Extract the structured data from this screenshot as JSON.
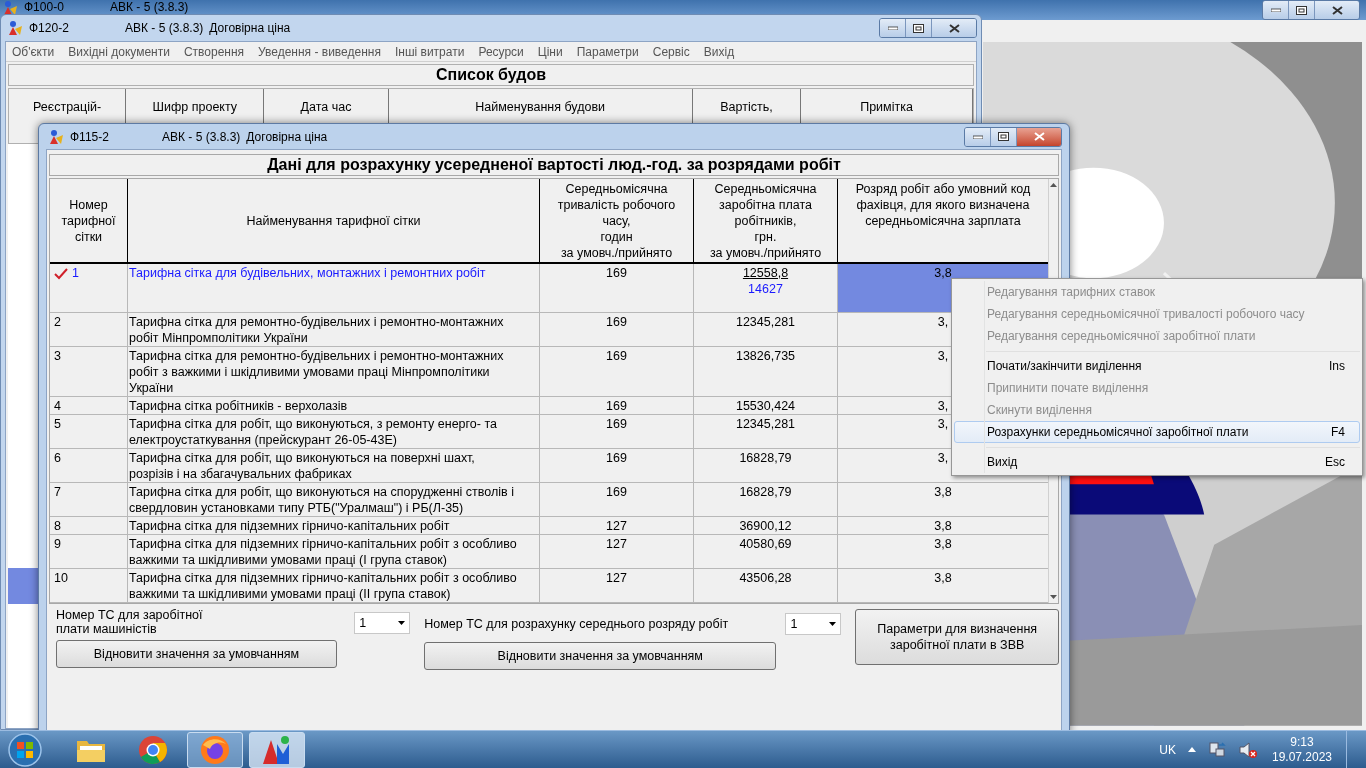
{
  "background_window": {
    "title": "Ф100-0",
    "app": "АВК - 5 (3.8.3)"
  },
  "list_window": {
    "title": "Ф120-2",
    "app": "АВК - 5 (3.8.3)",
    "mode": "Договірна ціна",
    "menu": [
      "Об'єкти",
      "Вихідні документи",
      "Створення",
      "Уведення - виведення",
      "Інші витрати",
      "Ресурси",
      "Ціни",
      "Параметри",
      "Сервіс",
      "Вихід"
    ],
    "heading": "Список будов",
    "columns": [
      "Реєстрацій-",
      "Шифр проекту",
      "Дата час",
      "Найменування будови",
      "Вартість,",
      "Примітка"
    ]
  },
  "dialog": {
    "title": "Ф115-2",
    "app": "АВК - 5 (3.8.3)",
    "mode": "Договірна ціна",
    "heading": "Дані для розрахунку усередненої вартості люд.-год. за розрядами робіт",
    "columns": [
      "Номер\nтарифної\nсітки",
      "Найменування тарифної сітки",
      "Середньомісячна\nтривалість робочого\nчасу,\nгодин\nза умовч./прийнято",
      "Середньомісячна\nзаробітна плата\nробітників,\nгрн.\nза умовч./прийнято",
      "Розряд робіт або умовний код\nфахівця, для якого визначена\nсередньомісячна зарплата"
    ],
    "rows": [
      {
        "number": "1",
        "selected": true,
        "name": "Тарифна сітка для будівельних, монтажних і ремонтних робіт",
        "hours": "169",
        "salary": "12558,8",
        "salary_accepted": "14627",
        "grade": "3,8"
      },
      {
        "number": "2",
        "selected": false,
        "name": "Тарифна сітка для ремонтно-будівельних і ремонтно-монтажних\nробіт Мінпромполітики України",
        "hours": "169",
        "salary": "12345,281",
        "grade": "3,"
      },
      {
        "number": "3",
        "selected": false,
        "name": "Тарифна сітка для ремонтно-будівельних і ремонтно-монтажних\nробіт з важкими і шкідливими умовами праці Мінпромполітики\nУкраїни",
        "hours": "169",
        "salary": "13826,735",
        "grade": "3,"
      },
      {
        "number": "4",
        "selected": false,
        "name": "Тарифна сітка робітників - верхолазів",
        "hours": "169",
        "salary": "15530,424",
        "grade": "3,"
      },
      {
        "number": "5",
        "selected": false,
        "name": "Тарифна сітка для робіт, що виконуються, з ремонту енерго- та\nелектроустаткування (прейскурант 26-05-43Е)",
        "hours": "169",
        "salary": "12345,281",
        "grade": "3,"
      },
      {
        "number": "6",
        "selected": false,
        "name": "Тарифна сітка для робіт, що виконуються на поверхні шахт,\nрозрізів і на збагачувальних фабриках",
        "hours": "169",
        "salary": "16828,79",
        "grade": "3,"
      },
      {
        "number": "7",
        "selected": false,
        "name": "Тарифна сітка для робіт, що виконуються на спорудженні стволів і\nсвердловин установками типу РТБ(\"Уралмаш\") і РБ(Л-35)",
        "hours": "169",
        "salary": "16828,79",
        "grade": "3,8"
      },
      {
        "number": "8",
        "selected": false,
        "name": "Тарифна сітка для підземних гірничо-капітальних робіт",
        "hours": "127",
        "salary": "36900,12",
        "grade": "3,8"
      },
      {
        "number": "9",
        "selected": false,
        "name": "Тарифна сітка для підземних гірничо-капітальних робіт з особливо\nважкими та шкідливими умовами праці (І група ставок)",
        "hours": "127",
        "salary": "40580,69",
        "grade": "3,8"
      },
      {
        "number": "10",
        "selected": false,
        "name": "Тарифна сітка для підземних гірничо-капітальних робіт з особливо\nважкими та шкідливими умовами праці (ІІ група ставок)",
        "hours": "127",
        "salary": "43506,28",
        "grade": "3,8"
      }
    ],
    "machinist_label": "Номер ТС для заробітної\nплати машиністів",
    "machinist_select": "1",
    "machinist_reset": "Відновити значення за умовчанням",
    "grade_label": "Номер ТС для розрахунку середнього розряду робіт",
    "grade_select": "1",
    "grade_reset": "Відновити значення за умовчанням",
    "zvv_button": "Параметри для визначення\nзаробітної плати в ЗВВ"
  },
  "context_menu": [
    {
      "kind": "item",
      "label": "Редагування тарифних ставок",
      "disabled": true,
      "selected": false
    },
    {
      "kind": "item",
      "label": "Редагування середньомісячної тривалості робочого часу",
      "disabled": true,
      "selected": false
    },
    {
      "kind": "item",
      "label": "Редагування середньомісячної заробітної плати",
      "disabled": true,
      "selected": false
    },
    {
      "kind": "separator"
    },
    {
      "kind": "item",
      "label": "Почати/закінчити виділення",
      "shortcut": "Ins",
      "disabled": false,
      "selected": false
    },
    {
      "kind": "item",
      "label": "Припинити почате виділення",
      "disabled": true,
      "selected": false
    },
    {
      "kind": "item",
      "label": "Скинути виділення",
      "disabled": true,
      "selected": false
    },
    {
      "kind": "item",
      "label": "Розрахунки середньомісячної заробітної плати",
      "shortcut": "F4",
      "disabled": false,
      "selected": true
    },
    {
      "kind": "separator"
    },
    {
      "kind": "item",
      "label": "Вихід",
      "shortcut": "Esc",
      "disabled": false,
      "selected": false
    }
  ],
  "taskbar": {
    "apps": [
      {
        "kind": "explorer",
        "running": false,
        "active": false
      },
      {
        "kind": "chrome",
        "running": false,
        "active": false
      },
      {
        "kind": "firefox",
        "running": true,
        "active": false
      },
      {
        "kind": "avk",
        "running": true,
        "active": true
      }
    ],
    "language": "UK",
    "time": "9:13",
    "date": "19.07.2023"
  }
}
